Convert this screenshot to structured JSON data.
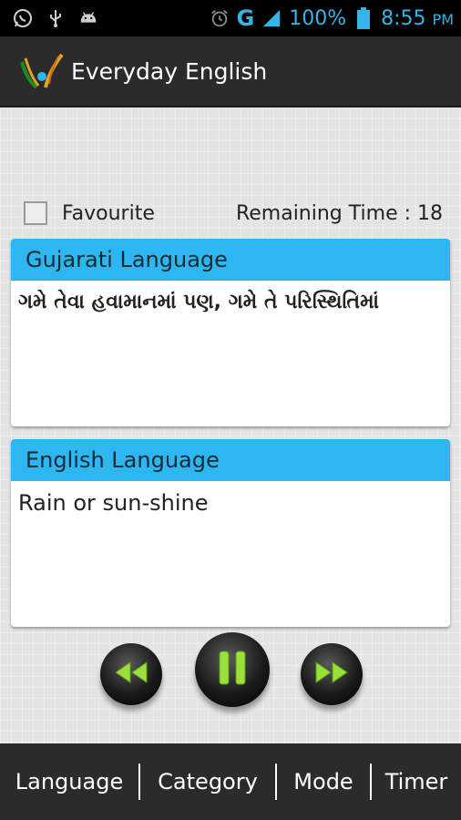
{
  "status_bar": {
    "left_icons": [
      "whatsapp-icon",
      "usb-icon",
      "android-icon"
    ],
    "alarm_icon": "alarm-icon",
    "network": "G",
    "battery_percent": "100%",
    "time": "8:55",
    "ampm": "PM"
  },
  "action_bar": {
    "title": "Everyday English"
  },
  "favourite": {
    "label": "Favourite",
    "checked": false
  },
  "remaining_time": "Remaining Time : 18",
  "panels": {
    "gujarati": {
      "header": "Gujarati Language",
      "text": "ગમે તેવા હવામાનમાં પણ, ગમે તે પરિસ્થિતિમાં"
    },
    "english": {
      "header": "English Language",
      "text": "Rain or sun-shine"
    }
  },
  "controls": {
    "rewind": "rewind-icon",
    "pause": "pause-icon",
    "forward": "fast-forward-icon"
  },
  "bottom_nav": {
    "items": [
      "Language",
      "Category",
      "Mode",
      "Timer"
    ]
  },
  "colors": {
    "accent": "#2cb7f1",
    "status_blue": "#33b5e5",
    "bar_background": "#2b2b2b",
    "control_icon": "#9be03a"
  }
}
